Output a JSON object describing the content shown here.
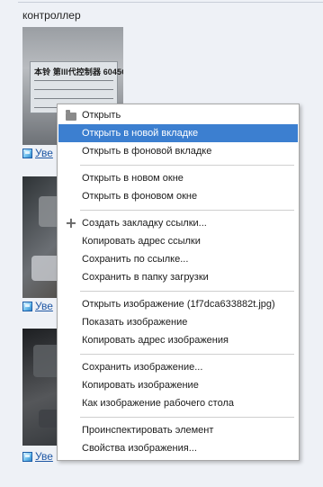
{
  "page": {
    "title": "контроллер",
    "view_link_text": "Уве"
  },
  "thumbnail_1": {
    "label_text": "本铃 第III代控制器 6045G"
  },
  "context_menu": {
    "items": [
      {
        "label": "Открыть",
        "icon": "folder-icon",
        "highlighted": false
      },
      {
        "label": "Открыть в новой вкладке",
        "highlighted": true
      },
      {
        "label": "Открыть в фоновой вкладке"
      },
      {
        "label": "Открыть в новом окне"
      },
      {
        "label": "Открыть в фоновом окне"
      },
      {
        "label": "Создать закладку ссылки...",
        "icon": "plus-icon"
      },
      {
        "label": "Копировать адрес ссылки"
      },
      {
        "label": "Сохранить по ссылке..."
      },
      {
        "label": "Сохранить в папку загрузки"
      },
      {
        "label": "Открыть изображение (1f7dca633882t.jpg)"
      },
      {
        "label": "Показать изображение"
      },
      {
        "label": "Копировать адрес изображения"
      },
      {
        "label": "Сохранить изображение..."
      },
      {
        "label": "Копировать изображение"
      },
      {
        "label": "Как изображение рабочего стола"
      },
      {
        "label": "Проинспектировать элемент"
      },
      {
        "label": "Свойства изображения..."
      }
    ]
  },
  "colors": {
    "page_background": "#eef1f6",
    "menu_highlight": "#3c7fd0",
    "link": "#1f57a4"
  }
}
